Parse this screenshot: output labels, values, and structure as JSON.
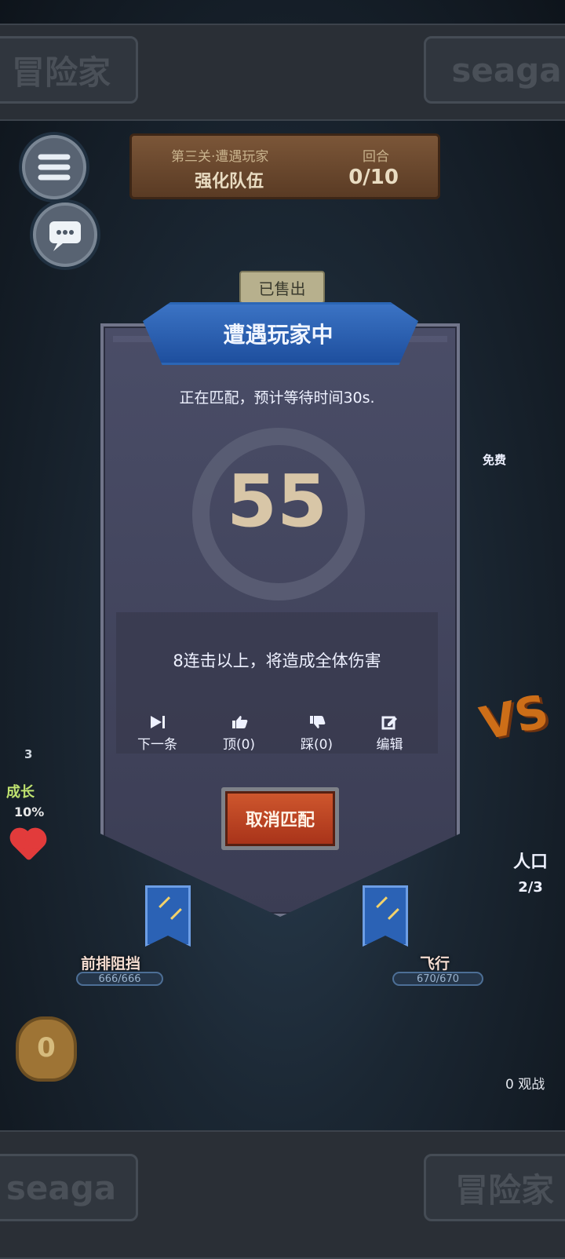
{
  "banner": {
    "left_text": "冒险家",
    "right_text": "seaga",
    "bottom_left_text": "seaga",
    "bottom_right_text": "冒险家"
  },
  "stage": {
    "title": "第三关·遭遇玩家",
    "subtitle": "强化队伍",
    "round_label": "回合",
    "round_value": "0/10"
  },
  "board": {
    "sold_label": "已售出",
    "free_label": "免费",
    "vs_label": "VS",
    "people_label": "人口",
    "people_value": "2/3",
    "growth_label": "成长",
    "growth_percent": "10%",
    "heart_value": "3",
    "gold_value": "0",
    "spectate_label": "0 观战",
    "left_unit": {
      "name": "前排阻挡",
      "hp": "666/666"
    },
    "right_unit": {
      "name": "飞行",
      "hp": "670/670"
    }
  },
  "modal": {
    "title": "遭遇玩家中",
    "matching_text": "正在匹配，预计等待时间30s.",
    "countdown": "55",
    "tip": "8连击以上，将造成全体伤害",
    "actions": [
      {
        "label": "下一条",
        "icon": "next-icon"
      },
      {
        "label": "顶(0)",
        "icon": "thumbs-up-icon"
      },
      {
        "label": "踩(0)",
        "icon": "thumbs-down-icon"
      },
      {
        "label": "编辑",
        "icon": "edit-icon"
      }
    ],
    "cancel_label": "取消匹配"
  },
  "colors": {
    "modal_bg": "#4a4d67",
    "ribbon_blue": "#2b62b5",
    "cancel_orange": "#c94f27",
    "countdown_beige": "#d8c6a7"
  }
}
